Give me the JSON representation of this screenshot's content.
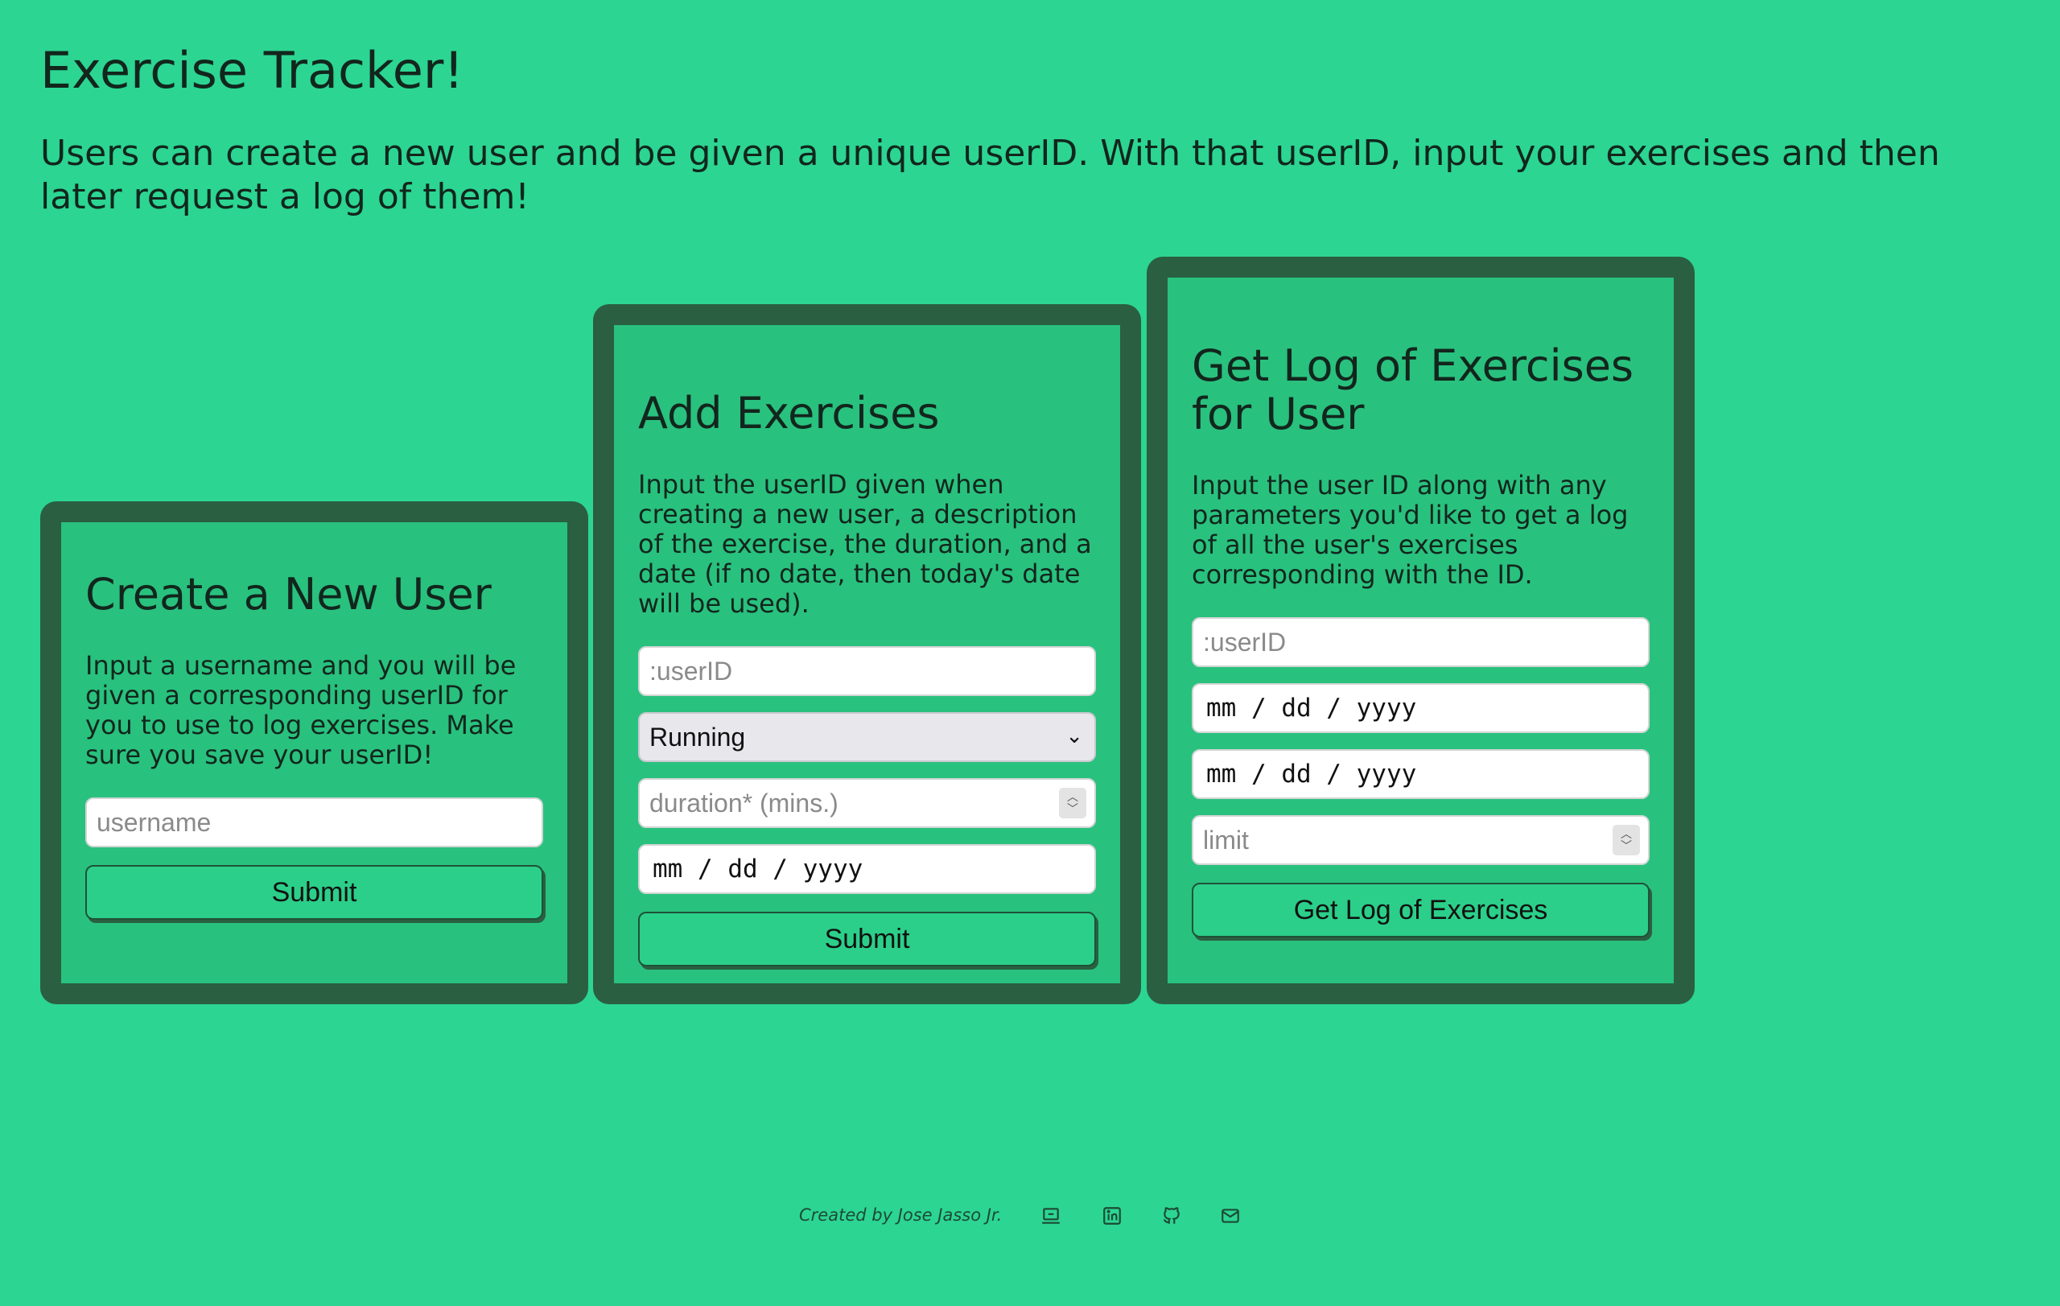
{
  "header": {
    "title": "Exercise Tracker!",
    "intro": "Users can create a new user and be given a unique userID. With that userID, input your exercises and then later request a log of them!"
  },
  "create_user": {
    "heading": "Create a New User",
    "description": "Input a username and you will be given a corresponding userID for you to use to log exercises. Make sure you save your userID!",
    "username_placeholder": "username",
    "submit_label": "Submit"
  },
  "add_exercises": {
    "heading": "Add Exercises",
    "description": "Input the userID given when creating a new user, a description of the exercise, the duration, and a date (if no date, then today's date will be used).",
    "userid_placeholder": ":userID",
    "exercise_select_value": "Running",
    "duration_placeholder": "duration* (mins.)",
    "date_value": "mm / dd / yyyy",
    "submit_label": "Submit"
  },
  "get_log": {
    "heading": "Get Log of Exercises for User",
    "description": "Input the user ID along with any parameters you'd like to get a log of all the user's exercises corresponding with the ID.",
    "userid_placeholder": ":userID",
    "from_date_value": "mm / dd / yyyy",
    "to_date_value": "mm / dd / yyyy",
    "limit_placeholder": "limit",
    "submit_label": "Get Log of Exercises"
  },
  "footer": {
    "credit": "Created by Jose Jasso Jr.",
    "icons": [
      "portfolio-icon",
      "linkedin-icon",
      "github-icon",
      "email-icon"
    ]
  },
  "colors": {
    "background": "#2cd592",
    "card_bg": "#29c17e",
    "card_border": "#2a5f42",
    "text": "#12261d"
  }
}
